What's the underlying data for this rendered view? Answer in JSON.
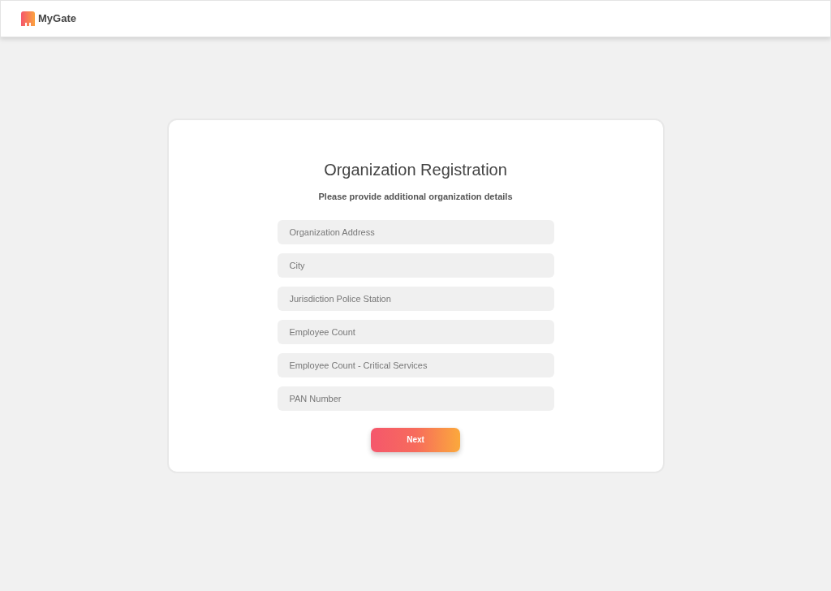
{
  "header": {
    "brand": "MyGate"
  },
  "form": {
    "title": "Organization Registration",
    "subtitle": "Please provide additional organization details",
    "fields": [
      {
        "placeholder": "Organization Address"
      },
      {
        "placeholder": "City"
      },
      {
        "placeholder": "Jurisdiction Police Station"
      },
      {
        "placeholder": "Employee Count"
      },
      {
        "placeholder": "Employee Count - Critical Services"
      },
      {
        "placeholder": "PAN Number"
      }
    ],
    "button": "Next"
  }
}
